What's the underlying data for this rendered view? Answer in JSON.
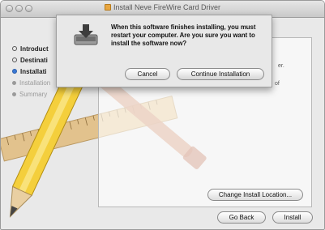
{
  "window": {
    "title": "Install Neve FireWire Card Driver"
  },
  "sidebar": {
    "steps": [
      {
        "label": "Introduct",
        "state": "done"
      },
      {
        "label": "Destinati",
        "state": "done"
      },
      {
        "label": "Installati",
        "state": "current"
      },
      {
        "label": "Installation",
        "state": "future"
      },
      {
        "label": "Summary",
        "state": "future"
      }
    ]
  },
  "dialog": {
    "message": "When this software finishes installing, you must restart your computer. Are you sure you want to install the software now?",
    "cancel_label": "Cancel",
    "continue_label": "Continue Installation"
  },
  "content": {
    "partial_line_1": "er.",
    "partial_line_2": "of"
  },
  "buttons": {
    "change_location_label": "Change Install Location...",
    "go_back_label": "Go Back",
    "install_label": "Install"
  },
  "colors": {
    "accent": "#3a78d6",
    "window_bg": "#e9e9e9"
  },
  "icons": {
    "dialog": "drive-install-icon",
    "title": "package-icon",
    "background": "pencil-ruler-art"
  }
}
